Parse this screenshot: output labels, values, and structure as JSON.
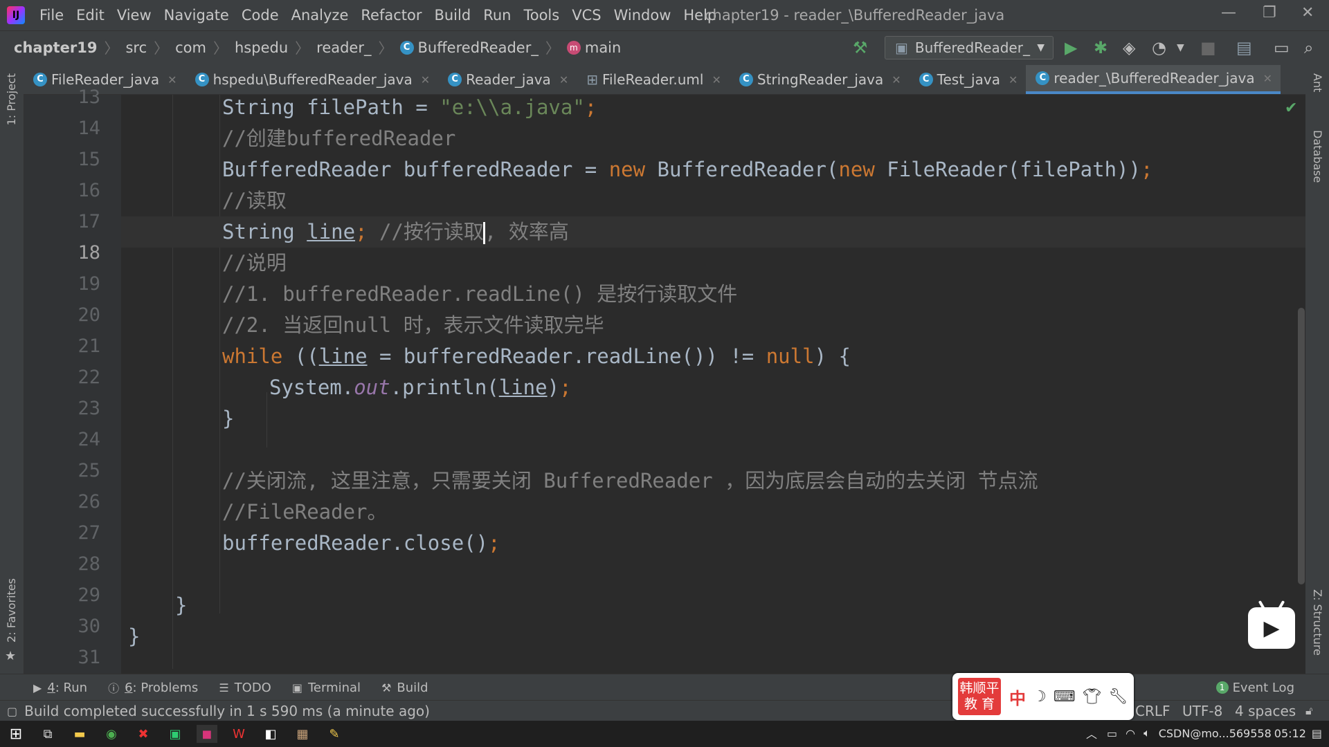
{
  "window": {
    "title": "chapter19 - reader_\\BufferedReader_java"
  },
  "menu": [
    "File",
    "Edit",
    "View",
    "Navigate",
    "Code",
    "Analyze",
    "Refactor",
    "Build",
    "Run",
    "Tools",
    "VCS",
    "Window",
    "Help"
  ],
  "breadcrumb": [
    "chapter19",
    "src",
    "com",
    "hspedu",
    "reader_",
    "BufferedReader_",
    "main"
  ],
  "run_config": "BufferedReader_",
  "tabs": [
    {
      "label": "FileReader_java",
      "icon": "C"
    },
    {
      "label": "hspedu\\BufferedReader_java",
      "icon": "C"
    },
    {
      "label": "Reader_java",
      "icon": "C"
    },
    {
      "label": "FileReader.uml",
      "icon": "uml"
    },
    {
      "label": "StringReader_java",
      "icon": "C"
    },
    {
      "label": "Test_java",
      "icon": "C"
    },
    {
      "label": "reader_\\BufferedReader_java",
      "icon": "C",
      "active": true
    }
  ],
  "side_panels": {
    "project": "1: Project",
    "favorites": "2: Favorites",
    "ant": "Ant",
    "database": "Database",
    "structure": "Z: Structure"
  },
  "code": {
    "line_numbers": [
      "13",
      "14",
      "15",
      "16",
      "17",
      "18",
      "19",
      "20",
      "21",
      "22",
      "23",
      "24",
      "25",
      "26",
      "27",
      "28",
      "29",
      "30",
      "31"
    ],
    "current_line": "18",
    "l14": {
      "type": "String ",
      "var": "filePath = ",
      "str": "\"e:\\\\a.java\"",
      "end": ";"
    },
    "l15": "//创建bufferedReader",
    "l16": {
      "a": "BufferedReader bufferedReader = ",
      "kw1": "new",
      "b": " BufferedReader(",
      "kw2": "new",
      "c": " FileReader(filePath))",
      "end": ";"
    },
    "l17": "//读取",
    "l18": {
      "a": "String ",
      "var": "line",
      "semi": ";",
      "cm1": " //按行读取",
      "cm2": ", 效率高"
    },
    "l19": "//说明",
    "l20": "//1. bufferedReader.readLine() 是按行读取文件",
    "l21": "//2. 当返回null 时，表示文件读取完毕",
    "l22": {
      "kw": "while",
      "a": " ((",
      "var": "line",
      "b": " = bufferedReader.readLine()) != ",
      "null": "null",
      "c": ") {"
    },
    "l23": {
      "a": "System.",
      "fld": "out",
      "b": ".println(",
      "var": "line",
      "c": ")",
      "end": ";"
    },
    "l24": "}",
    "l26": "//关闭流, 这里注意，只需要关闭 BufferedReader ，因为底层会自动的去关闭 节点流",
    "l27": "//FileReader。",
    "l28": {
      "a": "bufferedReader.close()",
      "end": ";"
    },
    "l30": "}",
    "l31": "}"
  },
  "tool_windows": [
    {
      "num": "4",
      "label": ": Run"
    },
    {
      "num": "6",
      "label": ": Problems"
    },
    {
      "num": "",
      "label": "TODO"
    },
    {
      "num": "",
      "label": "Terminal"
    },
    {
      "num": "",
      "label": "Build"
    }
  ],
  "event_log": "Event Log",
  "event_badge": "1",
  "status": {
    "message": "Build completed successfully in 1 s 590 ms (a minute ago)",
    "line_sep": "CRLF",
    "encoding": "UTF-8",
    "indent": "4 spaces"
  },
  "ime": {
    "brand": "韩顺平 教 育",
    "mode": "中"
  },
  "tray": {
    "text": "CSDN@mo...569558",
    "time": "05:12"
  }
}
